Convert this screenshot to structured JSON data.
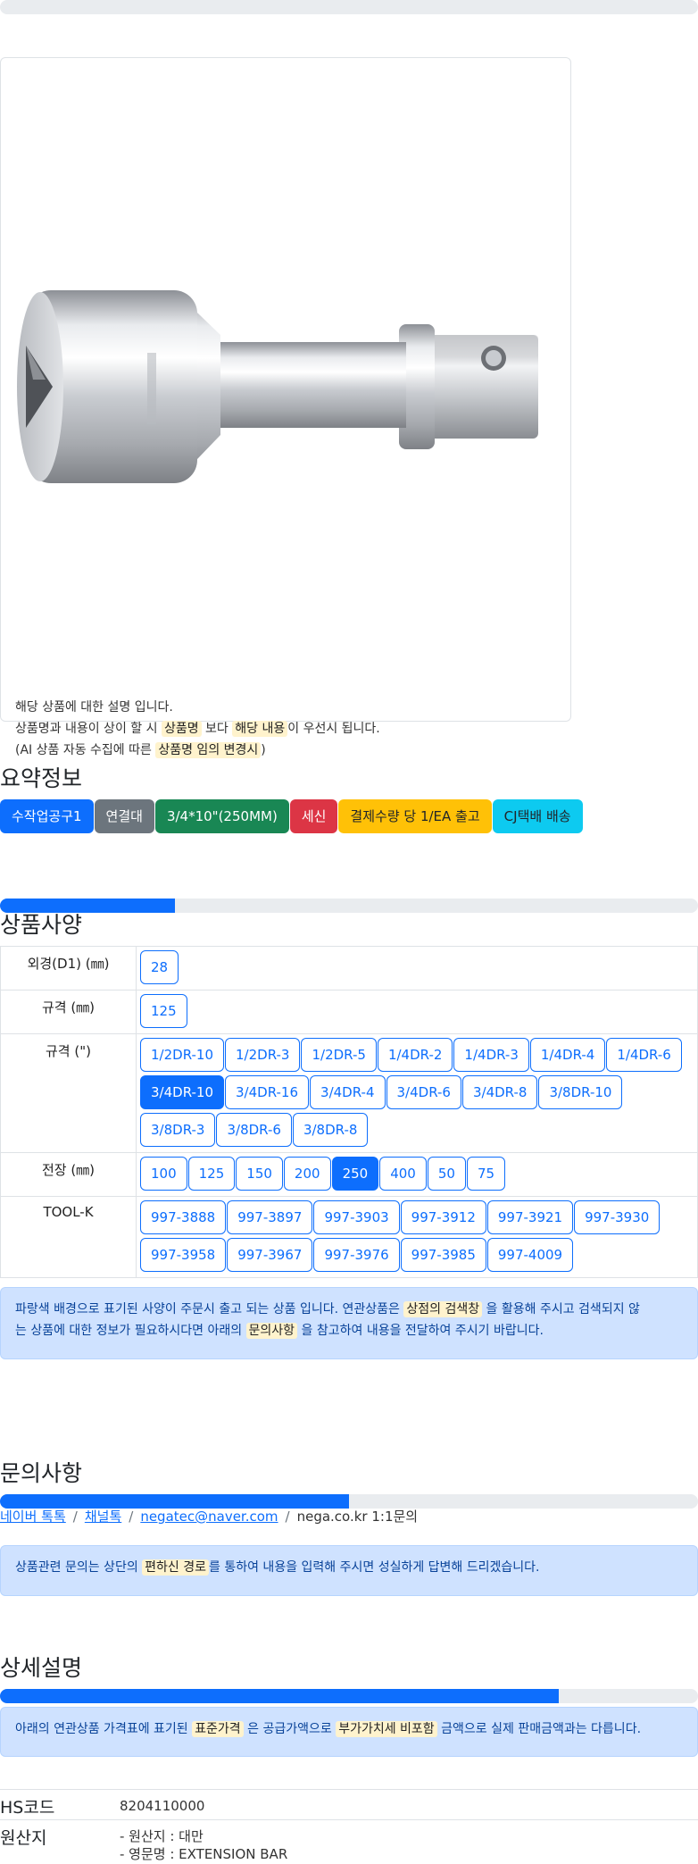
{
  "product_card": {
    "desc_line1": "해당 상품에 대한 설명 입니다.",
    "desc_line2_pre": "상품명과 내용이 상이 할 시",
    "desc_line2_hl1": "상품명",
    "desc_line2_mid": "보다",
    "desc_line2_hl2": "해당 내용",
    "desc_line2_post": "이 우선시 됩니다.",
    "desc_line3_pre": "(AI 상품 자동 수집에 따른",
    "desc_line3_hl": "상품명 임의 변경시",
    "desc_line3_post": ")"
  },
  "summary": {
    "title": "요약정보",
    "badges": [
      {
        "label": "수작업공구1",
        "color": "#0d6efd"
      },
      {
        "label": "연결대",
        "color": "#6c757d"
      },
      {
        "label": "3/4*10\"(250MM)",
        "color": "#198754"
      },
      {
        "label": "세신",
        "color": "#dc3545"
      },
      {
        "label": "결제수량 당 1/EA 출고",
        "color": "#ffc107",
        "text_color": "#212529"
      },
      {
        "label": "CJ택배 배송",
        "color": "#0dcaf0",
        "text_color": "#212529"
      }
    ]
  },
  "spec": {
    "title": "상품사양",
    "progress": 0.25,
    "rows": [
      {
        "label": "외경(D1) (㎜)",
        "options": [
          "28"
        ],
        "active": []
      },
      {
        "label": "규격 (㎜)",
        "options": [
          "125"
        ],
        "active": []
      },
      {
        "label": "규격 (\")",
        "options": [
          "1/2DR-10",
          "1/2DR-3",
          "1/2DR-5",
          "1/4DR-2",
          "1/4DR-3",
          "1/4DR-4",
          "1/4DR-6",
          "3/4DR-10",
          "3/4DR-16",
          "3/4DR-4",
          "3/4DR-6",
          "3/4DR-8",
          "3/8DR-10",
          "3/8DR-3",
          "3/8DR-6",
          "3/8DR-8"
        ],
        "active": [
          "3/4DR-10"
        ]
      },
      {
        "label": "전장 (㎜)",
        "options": [
          "100",
          "125",
          "150",
          "200",
          "250",
          "400",
          "50",
          "75"
        ],
        "active": [
          "250"
        ]
      },
      {
        "label": "TOOL-K",
        "options": [
          "997-3888",
          "997-3897",
          "997-3903",
          "997-3912",
          "997-3921",
          "997-3930",
          "997-3958",
          "997-3967",
          "997-3976",
          "997-3985",
          "997-4009"
        ],
        "active": []
      }
    ],
    "notice_line1_pre": "파랑색 배경으로 표기된 사양이 주문시 출고 되는 상품 입니다. 연관상품은",
    "notice_line1_hl": "상점의 검색창",
    "notice_line1_post": "을 활용해 주시고 검색되지 않",
    "notice_line2_pre": "는 상품에 대한 정보가 필요하시다면 아래의",
    "notice_line2_hl": "문의사항",
    "notice_line2_post": "을 참고하여 내용을 전달하여 주시기 바랍니다."
  },
  "inquiry": {
    "title": "문의사항",
    "progress": 0.5,
    "link1": "네이버 톡톡",
    "link2": "채널톡",
    "link3": "negatec@naver.com",
    "text4": "nega.co.kr 1:1문의",
    "separator": "/",
    "notice_pre": "상품관련 문의는 상단의",
    "notice_hl": "편하신 경로",
    "notice_post": "를 통하여 내용을 입력해 주시면 성실하게 답변해 드리겠습니다."
  },
  "detail": {
    "title": "상세설명",
    "progress": 0.8,
    "notice_pre": "아래의 연관상품 가격표에 표기된",
    "notice_hl1": "표준가격",
    "notice_mid": "은 공급가액으로",
    "notice_hl2": "부가가치세 비포함",
    "notice_post": "금액으로 실제 판매금액과는 다릅니다.",
    "hs_label": "HS코드",
    "hs_value": "8204110000",
    "origin_label": "원산지",
    "origin_line1": "- 원산지 : 대만",
    "origin_line2": "- 영문명 : EXTENSION BAR"
  }
}
